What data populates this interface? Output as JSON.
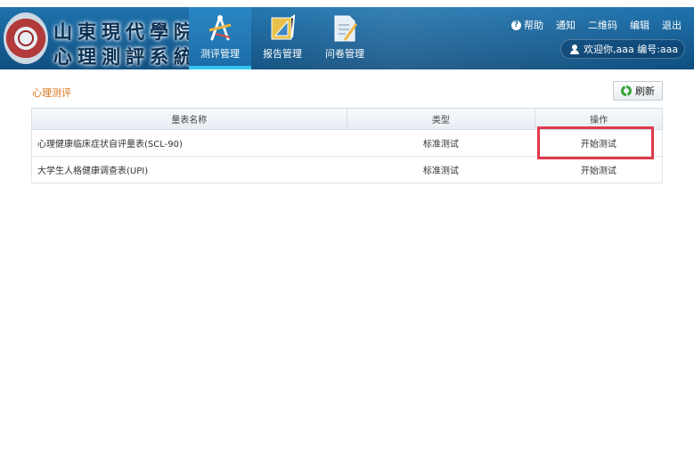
{
  "header": {
    "school_name": "山東現代學院",
    "system_name": "心理測評系統",
    "nav": [
      {
        "label": "测评管理",
        "icon": "compass-ruler-icon",
        "active": true
      },
      {
        "label": "报告管理",
        "icon": "triangle-ruler-icon",
        "active": false
      },
      {
        "label": "问卷管理",
        "icon": "document-pencil-icon",
        "active": false
      }
    ],
    "links": {
      "help": "帮助",
      "notice": "通知",
      "qrcode": "二维码",
      "edit": "编辑",
      "logout": "退出"
    },
    "user_text": "欢迎你,aaa 编号:aaa"
  },
  "main": {
    "title": "心理测评",
    "refresh_label": "刷新",
    "table": {
      "headers": {
        "name": "量表名称",
        "type": "类型",
        "action": "操作"
      },
      "rows": [
        {
          "name": "心理健康临床症状自评量表(SCL-90)",
          "type": "标准测试",
          "action": "开始测试"
        },
        {
          "name": "大学生人格健康调查表(UPI)",
          "type": "标准测试",
          "action": "开始测试"
        }
      ]
    }
  },
  "colors": {
    "header_blue": "#165f95",
    "title_orange": "#d8731a",
    "highlight_red": "#e03a4a"
  }
}
